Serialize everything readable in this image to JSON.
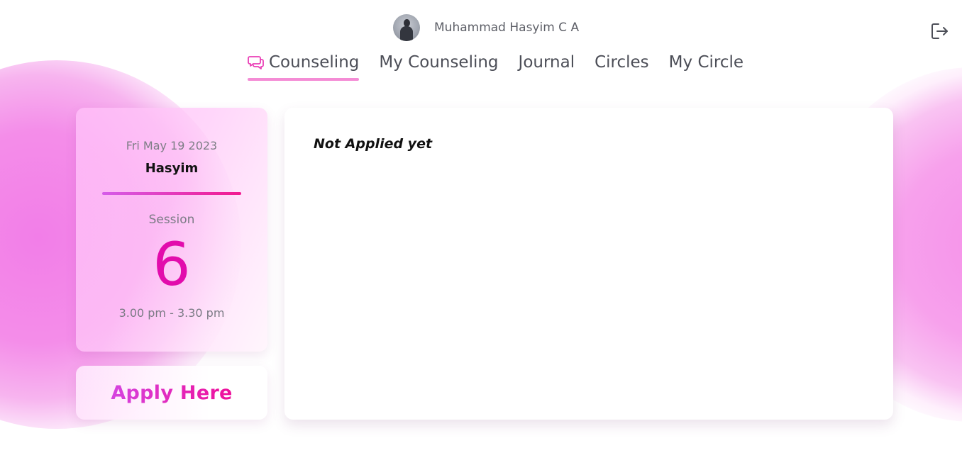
{
  "header": {
    "user_name": "Muhammad Hasyim C A",
    "logout_icon": "logout-icon"
  },
  "nav": {
    "items": [
      {
        "label": "Counseling",
        "active": true,
        "icon": "chat-bubbles-icon"
      },
      {
        "label": "My Counseling",
        "active": false
      },
      {
        "label": "Journal",
        "active": false
      },
      {
        "label": "Circles",
        "active": false
      },
      {
        "label": "My Circle",
        "active": false
      }
    ]
  },
  "session_card": {
    "date": "Fri May 19 2023",
    "name": "Hasyim",
    "session_label": "Session",
    "session_number": "6",
    "time": "3.00 pm - 3.30 pm"
  },
  "apply": {
    "label": "Apply Here"
  },
  "main": {
    "status": "Not Applied yet"
  },
  "colors": {
    "accent": "#e20cac",
    "accent_gradient_start": "#d544e0",
    "accent_gradient_end": "#ef0f9a",
    "nav_underline": "#f48cd5",
    "background_blob": "#f48de9"
  }
}
